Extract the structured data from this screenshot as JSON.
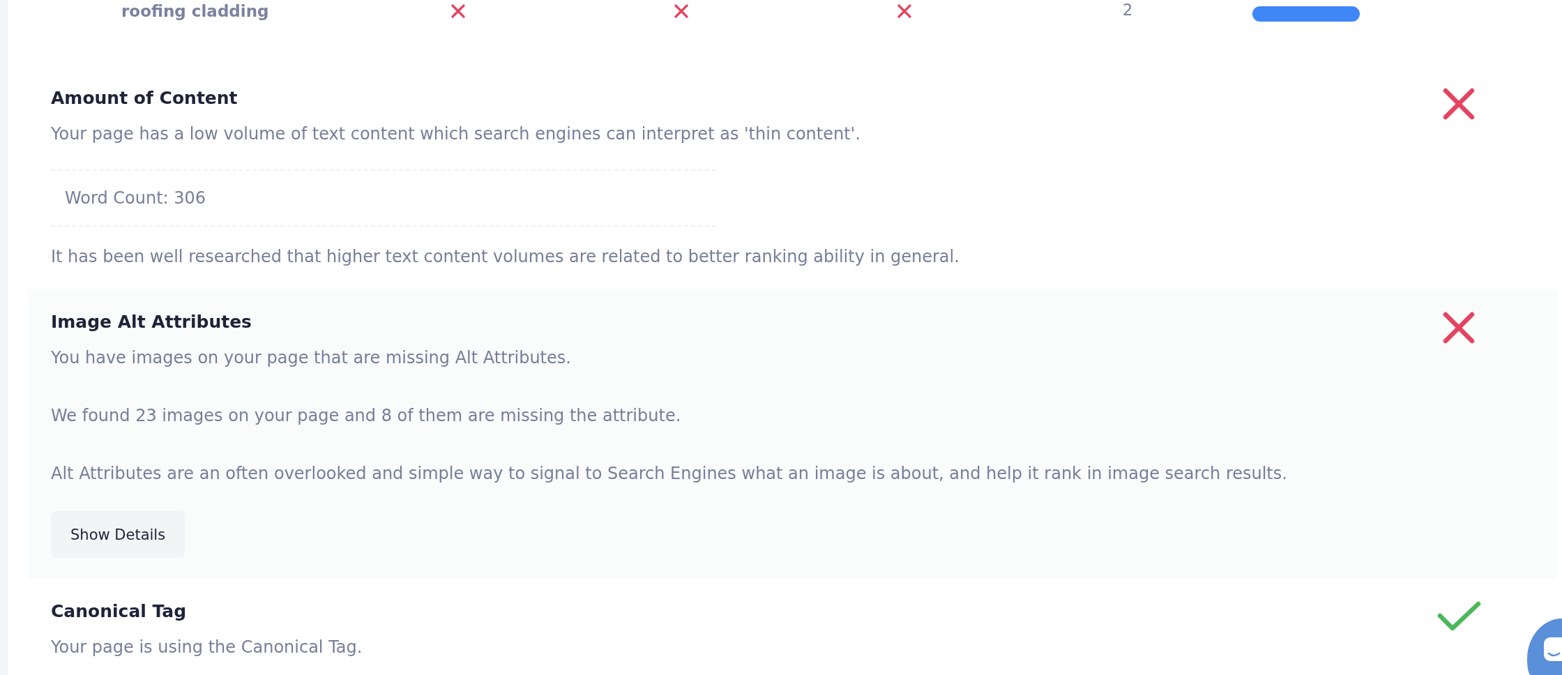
{
  "keyword_table": {
    "rows": [
      {
        "keyword": "roofing cladding",
        "checks": [
          {
            "passed": false
          },
          {
            "passed": false
          },
          {
            "passed": false
          }
        ],
        "count": "2"
      }
    ]
  },
  "sections": [
    {
      "title": "Amount of Content",
      "passed": false,
      "blocks": [
        {
          "kind": "text",
          "text": "Your page has a low volume of text content which search engines can interpret as 'thin content'."
        },
        {
          "kind": "stat",
          "text": "Word Count: 306"
        },
        {
          "kind": "text",
          "text": "It has been well researched that higher text content volumes are related to better ranking ability in general."
        }
      ]
    },
    {
      "title": "Image Alt Attributes",
      "passed": false,
      "blocks": [
        {
          "kind": "text",
          "text": "You have images on your page that are missing Alt Attributes."
        },
        {
          "kind": "text",
          "text": "We found 23 images on your page and 8 of them are missing the attribute."
        },
        {
          "kind": "text",
          "text": "Alt Attributes are an often overlooked and simple way to signal to Search Engines what an image is about, and help it rank in image search results."
        },
        {
          "kind": "button",
          "text": "Show Details"
        }
      ]
    },
    {
      "title": "Canonical Tag",
      "passed": true,
      "blocks": [
        {
          "kind": "text",
          "text": "Your page is using the Canonical Tag."
        }
      ]
    }
  ]
}
